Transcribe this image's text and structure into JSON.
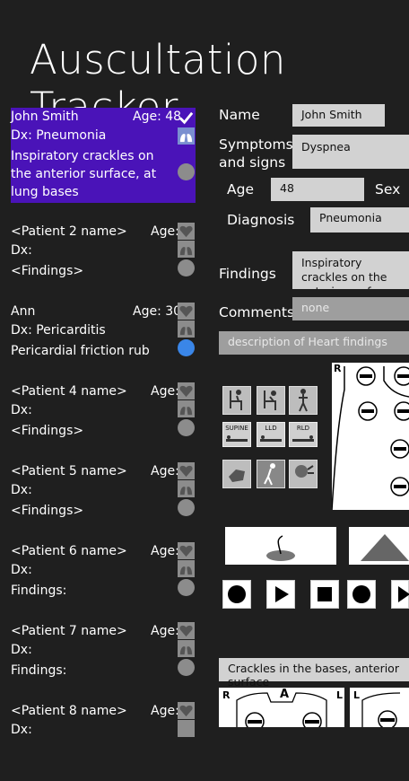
{
  "app": {
    "title": "Auscultation Tracker"
  },
  "patients": [
    {
      "name": "John Smith",
      "age": "Age: 48",
      "dx": "Dx: Pneumonia",
      "findings": "Inspiratory crackles on the anterior surface, at lung bases"
    },
    {
      "name": "<Patient 2 name>",
      "age": "Age:",
      "dx": "Dx:",
      "findings": "<Findings>"
    },
    {
      "name": "Ann",
      "age": "Age: 30",
      "dx": "Dx: Pericarditis",
      "findings": "Pericardial friction rub"
    },
    {
      "name": "<Patient 4 name>",
      "age": "Age:",
      "dx": "Dx:",
      "findings": "<Findings>"
    },
    {
      "name": "<Patient 5 name>",
      "age": "Age:",
      "dx": "Dx:",
      "findings": "<Findings>"
    },
    {
      "name": "<Patient 6 name>",
      "age": "Age:",
      "dx": "Dx:",
      "findings": "Findings:"
    },
    {
      "name": "<Patient 7 name>",
      "age": "Age:",
      "dx": "Dx:",
      "findings": "Findings:"
    },
    {
      "name": "<Patient 8 name>",
      "age": "Age:",
      "dx": "Dx:",
      "findings": ""
    }
  ],
  "form": {
    "name_label": "Name",
    "name_value": "John Smith",
    "symptoms_label": "Symptoms and signs",
    "symptoms_value": "Dyspnea",
    "age_label": "Age",
    "age_value": "48",
    "sex_label": "Sex",
    "diagnosis_label": "Diagnosis",
    "diagnosis_value": "Pneumonia",
    "findings_label": "Findings",
    "findings_value": "Inspiratory crackles on the anterior surface, at lung bases",
    "comments_label": "Comments",
    "comments_placeholder": "none",
    "heart_placeholder": "description of Heart findings",
    "lung_summary": "Crackles in the bases, anterior surface"
  },
  "positions": {
    "supine": "SUPINE",
    "lld": "LLD",
    "rld": "RLD"
  },
  "diagram": {
    "right_label": "R",
    "anterior_label": "A",
    "left_label": "L"
  },
  "colors": {
    "background": "#1f1f1f",
    "selected": "#4a13b8",
    "field": "#d2d2d2",
    "active_sound": "#3a86e8"
  },
  "icons": [
    "check-icon",
    "heart-icon",
    "lungs-icon",
    "sound-circle-icon",
    "record-icon",
    "play-icon",
    "stop-icon"
  ]
}
